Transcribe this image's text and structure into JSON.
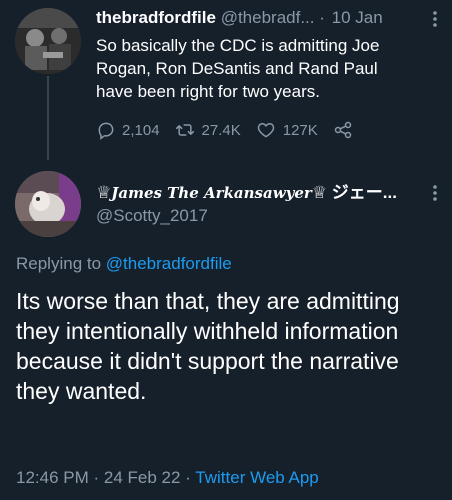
{
  "parent_tweet": {
    "display_name": "thebradfordfile",
    "handle": "@thebradf...",
    "separator": "·",
    "date": "10 Jan",
    "text": "So basically the CDC is admitting Joe Rogan, Ron DeSantis and Rand Paul have been right for two years.",
    "metrics": {
      "replies": "2,104",
      "retweets": "27.4K",
      "likes": "127K"
    },
    "icons": [
      "reply-icon",
      "retweet-icon",
      "like-icon",
      "share-icon",
      "more-icon"
    ]
  },
  "reply_tweet": {
    "display_name_prefix": "♕",
    "display_name_script": "James The Arkansawyer",
    "display_name_suffix": "♕ ジェー...",
    "handle": "@Scotty_2017",
    "replying_to_label": "Replying to",
    "replying_to_handle": "@thebradfordfile",
    "text": "Its worse than that, they are admitting they intentionally withheld information because it didn't support the narrative they wanted.",
    "time": "12:46 PM",
    "separator1": "·",
    "date": "24 Feb 22",
    "separator2": "·",
    "source": "Twitter Web App"
  },
  "colors": {
    "background": "#15202b",
    "primary_text": "#ffffff",
    "secondary_text": "#8b98a5",
    "link": "#1d9bf0",
    "thread_line": "#38444d"
  }
}
